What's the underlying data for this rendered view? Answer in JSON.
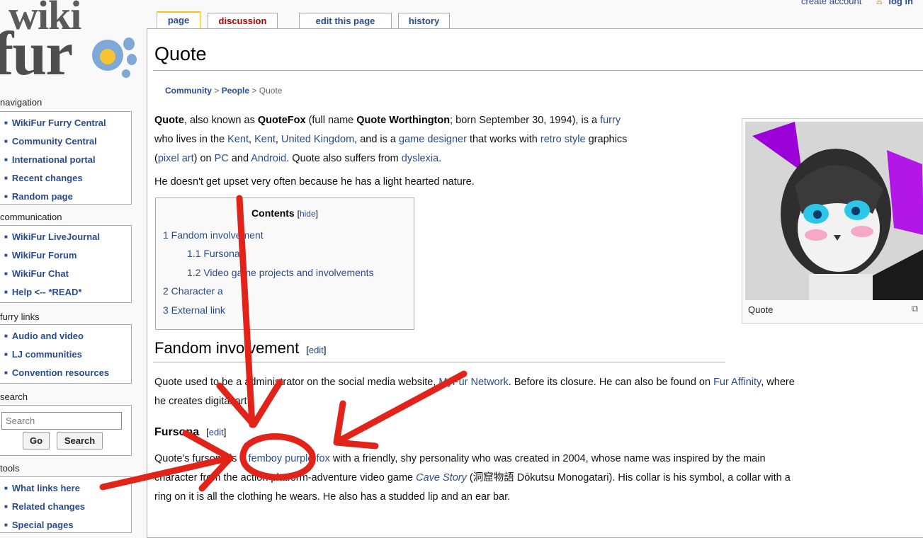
{
  "header": {
    "create_account": "create account",
    "login": "log in"
  },
  "logo": {
    "top": "wiki",
    "bottom": "fur"
  },
  "sidebar": {
    "navigation": {
      "title": "navigation",
      "items": [
        "WikiFur Furry Central",
        "Community Central",
        "International portal",
        "Recent changes",
        "Random page"
      ]
    },
    "communication": {
      "title": "communication",
      "items": [
        "WikiFur LiveJournal",
        "WikiFur Forum",
        "WikiFur Chat",
        "Help <-- *READ*"
      ]
    },
    "furry_links": {
      "title": "furry links",
      "items": [
        "Audio and video",
        "LJ communities",
        "Convention resources"
      ]
    },
    "search": {
      "title": "search",
      "placeholder": "Search",
      "go_label": "Go",
      "search_label": "Search"
    },
    "tools": {
      "title": "tools",
      "items": [
        "What links here",
        "Related changes",
        "Special pages"
      ]
    }
  },
  "tabs": [
    {
      "label": "page",
      "selected": true
    },
    {
      "label": "discussion",
      "red": true
    },
    {
      "label": "edit this page"
    },
    {
      "label": "history"
    }
  ],
  "page": {
    "title": "Quote",
    "breadcrumb": {
      "community": "Community",
      "people": "People",
      "current": "Quote",
      "sep": ">"
    },
    "intro": {
      "name": "Quote",
      "t1": ", also known as ",
      "alias": "QuoteFox",
      "t2": " (full name ",
      "full_name": "Quote Worthington",
      "t3": "; born September 30, 1994), is a ",
      "furry": "furry",
      "t4": "who lives in the ",
      "kent1": "Kent",
      "comma1": ", ",
      "kent2": "Kent",
      "comma2": ", ",
      "uk": "United Kingdom",
      "t5": ", and is a ",
      "game_designer": "game designer",
      "t6": " that works with ",
      "retro": "retro style",
      "t7": " graphics",
      "open_paren": "(",
      "pixel_art": "pixel art",
      "t8": ") on ",
      "pc": "PC",
      "t9": " and ",
      "android": "Android",
      "t10": ". Quote also suffers from ",
      "dyslexia": "dyslexia",
      "period": "."
    },
    "second_para": "He doesn't get upset very often because he has a light hearted nature.",
    "toc": {
      "title": "Contents",
      "hide_open": "[",
      "hide": "hide",
      "hide_close": "]",
      "items": [
        "1 Fandom involvement",
        "1.1 Fursona",
        "1.2 Video game projects and involvements",
        "2 Character a",
        "3 External link"
      ]
    },
    "thumb": {
      "caption": "Quote"
    },
    "fandom": {
      "heading": "Fandom involvement",
      "edit_open": "[",
      "edit": "edit",
      "edit_close": "]",
      "t1": "Quote used to be a administrator on the social media website, ",
      "myfur": "MyFur Network",
      "t2": ". Before its closure. He can also be found on ",
      "fa": "Fur Affinity",
      "t3": ", where",
      "t4": "he creates digital art."
    },
    "fursona": {
      "heading": "Fursona",
      "edit_open": "[",
      "edit": "edit",
      "edit_close": "]",
      "t1": "Quote's fursona is a ",
      "femboy": "femboy",
      "sp": " ",
      "purple_fox": "purple fox",
      "t2": " with a friendly, shy personality who was created in 2004, whose name was inspired by the main",
      "t3": "character from the action platform-adventure video game ",
      "cave_story": "Cave Story",
      "t4": " (洞窟物語 Dōkutsu Monogatari). His collar is his symbol, a collar with a",
      "t5": "ring on it is all the clothing he wears. He also has a studded lip and an ear bar."
    }
  },
  "colors": {
    "link": "#2a4b8d",
    "red_link": "#ba0000",
    "tab_selected": "#fabd23",
    "annotation": "#e2231a"
  }
}
